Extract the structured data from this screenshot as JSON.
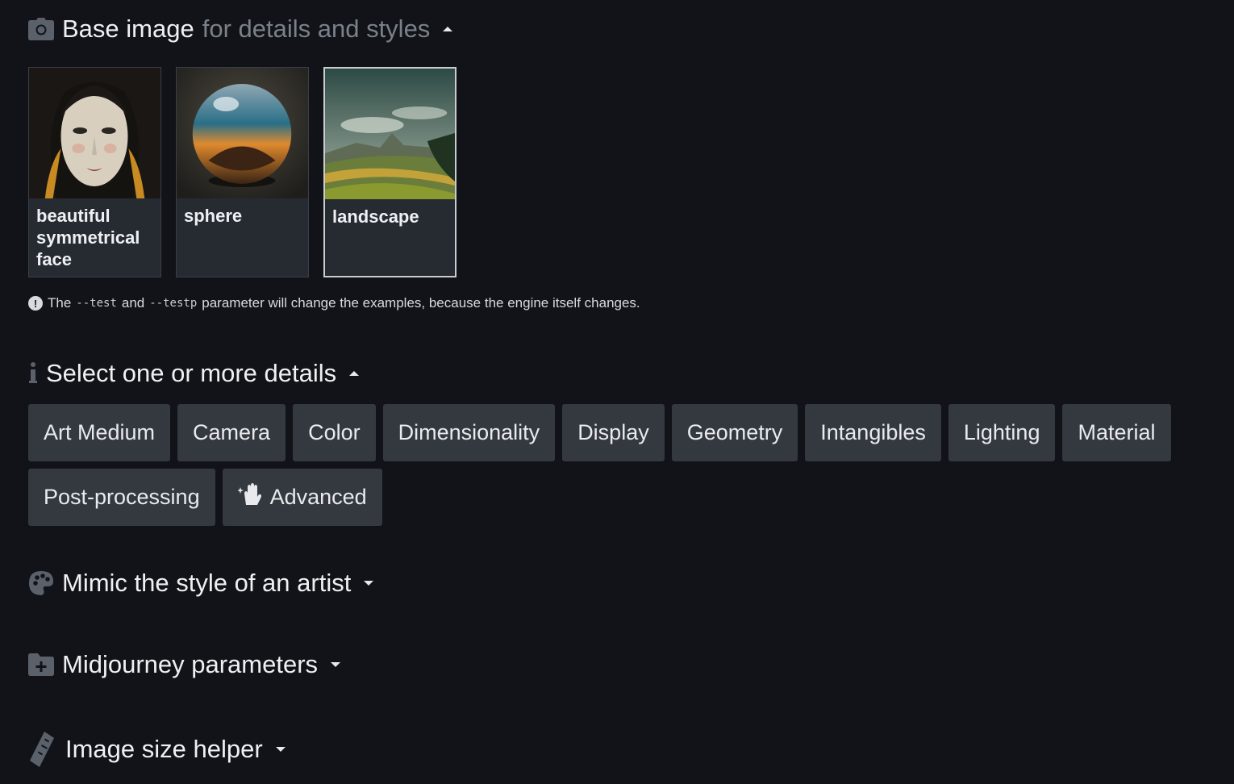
{
  "base_image": {
    "title": "Base image",
    "subtitle": "for details and styles",
    "cards": [
      {
        "label": "beautiful symmetrical face"
      },
      {
        "label": "sphere"
      },
      {
        "label": "landscape"
      }
    ],
    "note": {
      "pre": "The",
      "code1": "--test",
      "mid": "and",
      "code2": "--testp",
      "post": "parameter will change the examples, because the engine itself changes."
    }
  },
  "details": {
    "title": "Select one or more details",
    "chips": [
      "Art Medium",
      "Camera",
      "Color",
      "Dimensionality",
      "Display",
      "Geometry",
      "Intangibles",
      "Lighting",
      "Material",
      "Post-processing",
      "Advanced"
    ]
  },
  "artist": {
    "title": "Mimic the style of an artist"
  },
  "params": {
    "title": "Midjourney parameters"
  },
  "size": {
    "title": "Image size helper"
  },
  "icons": {
    "base": "camera-icon",
    "details": "info-icon",
    "artist": "palette-icon",
    "params": "folder-plus-icon",
    "size": "ruler-icon",
    "advanced": "sparkle-hand-icon",
    "note": "exclamation-icon"
  }
}
